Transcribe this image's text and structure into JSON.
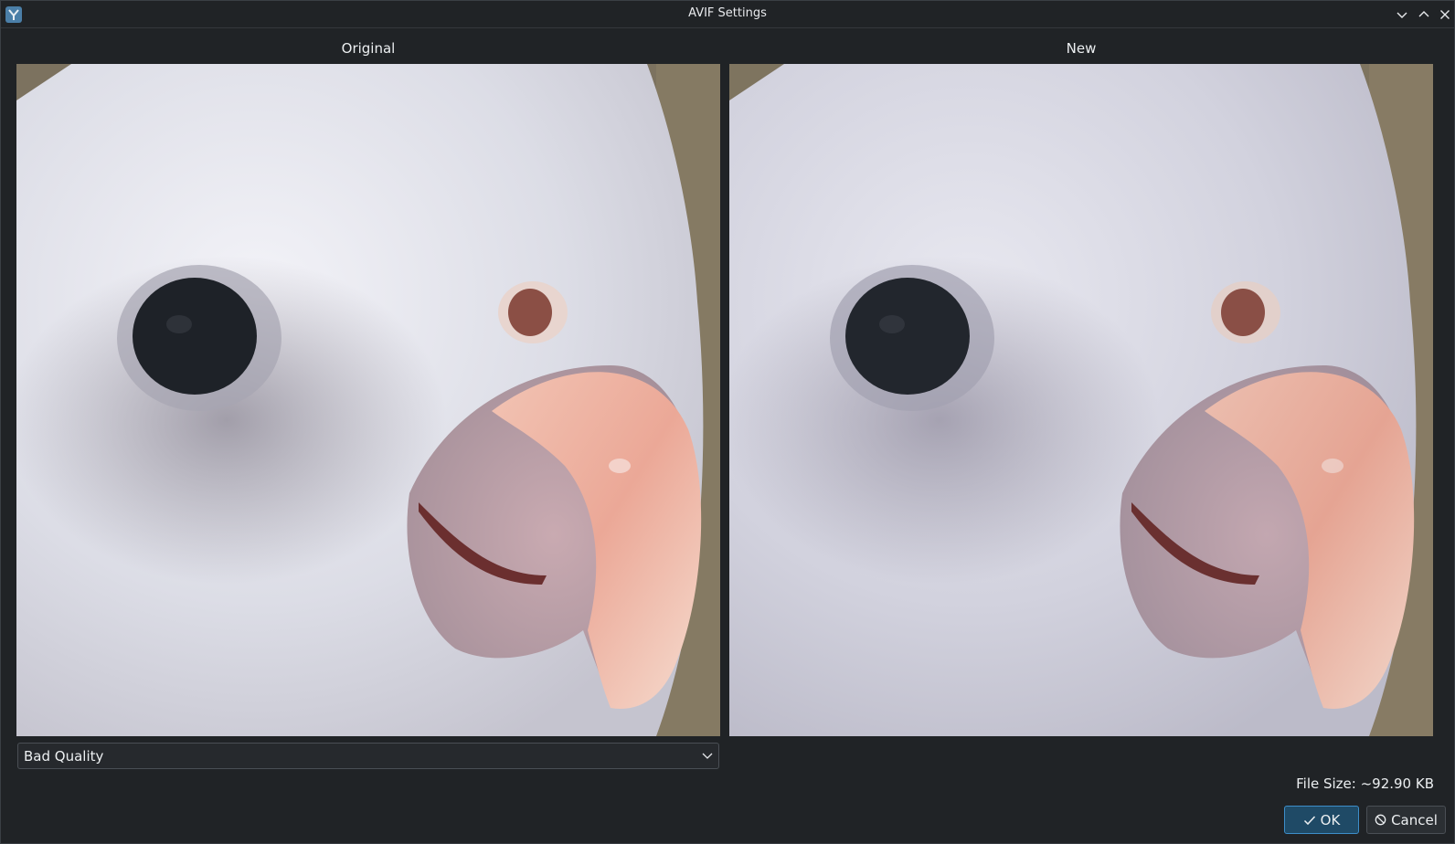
{
  "window": {
    "title": "AVIF Settings"
  },
  "panes": {
    "original_label": "Original",
    "new_label": "New"
  },
  "quality": {
    "selected": "Bad Quality"
  },
  "file_size": "File Size: ~92.90 KB",
  "buttons": {
    "ok_label": "OK",
    "cancel_label": "Cancel"
  },
  "icons": {
    "app": "app-icon",
    "minimize": "chevron-down-icon",
    "maximize": "chevron-up-icon",
    "close": "close-icon",
    "ok": "checkmark-icon",
    "cancel": "cancel-icon"
  },
  "colors": {
    "accent": "#3d8ec9",
    "background": "#202326"
  }
}
